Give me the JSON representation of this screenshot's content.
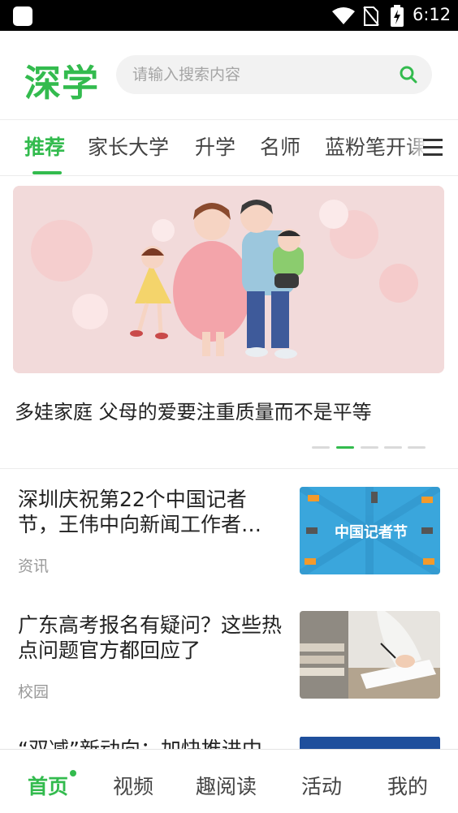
{
  "status_bar": {
    "time": "6:12"
  },
  "header": {
    "logo": "深学",
    "search_placeholder": "请输入搜索内容"
  },
  "tabs": [
    {
      "label": "推荐",
      "active": true
    },
    {
      "label": "家长大学"
    },
    {
      "label": "升学"
    },
    {
      "label": "名师"
    },
    {
      "label": "蓝粉笔开课"
    }
  ],
  "banner": {
    "title": "多娃家庭 父母的爱要注重质量而不是平等",
    "slide_count": 5,
    "active_slide": 2
  },
  "news": [
    {
      "title": "深圳庆祝第22个中国记者节，王伟中向新闻工作者…",
      "tag": "资讯",
      "thumb_text": "中国记者节"
    },
    {
      "title": "广东高考报名有疑问？这些热点问题官方都回应了",
      "tag": "校园"
    },
    {
      "title": "“双减”新动向：加快推进中"
    }
  ],
  "bottom_nav": [
    {
      "label": "首页",
      "active": true
    },
    {
      "label": "视频"
    },
    {
      "label": "趣阅读"
    },
    {
      "label": "活动"
    },
    {
      "label": "我的"
    }
  ],
  "colors": {
    "brand": "#33bb4e",
    "text": "#222222",
    "muted": "#999999"
  }
}
